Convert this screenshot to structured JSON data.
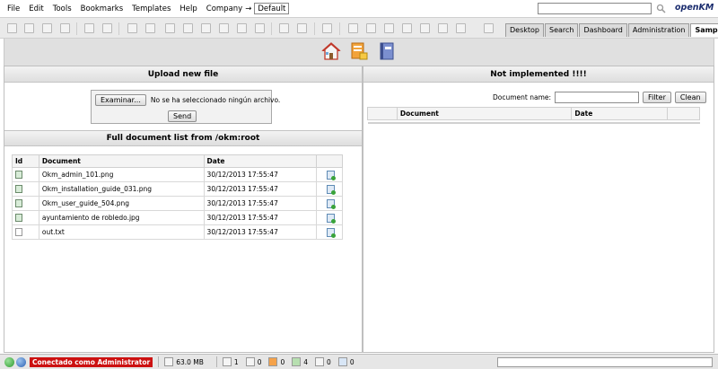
{
  "menu": {
    "items": [
      "File",
      "Edit",
      "Tools",
      "Bookmarks",
      "Templates",
      "Help"
    ],
    "company_label": "Company",
    "company_arrow": "→",
    "workspace_value": "Default"
  },
  "logo": {
    "brand": "openKM",
    "text_main": "penKM",
    "o_part": "o"
  },
  "tabs": [
    "Desktop",
    "Search",
    "Dashboard",
    "Administration",
    "Sample"
  ],
  "active_tab": "Sample",
  "upload": {
    "title": "Upload new file",
    "browse_label": "Examinar...",
    "file_status": "No se ha seleccionado ningún archivo.",
    "send_label": "Send"
  },
  "doc_list": {
    "title": "Full document list from /okm:root",
    "columns": [
      "Id",
      "Document",
      "Date"
    ],
    "rows": [
      {
        "document": "Okm_admin_101.png",
        "date": "30/12/2013 17:55:47",
        "type": "image"
      },
      {
        "document": "Okm_installation_guide_031.png",
        "date": "30/12/2013 17:55:47",
        "type": "image"
      },
      {
        "document": "Okm_user_guide_504.png",
        "date": "30/12/2013 17:55:47",
        "type": "image"
      },
      {
        "document": "ayuntamiento de robledo.jpg",
        "date": "30/12/2013 17:55:47",
        "type": "image"
      },
      {
        "document": "out.txt",
        "date": "30/12/2013 17:55:47",
        "type": "text"
      }
    ]
  },
  "not_implemented": {
    "title": "Not implemented !!!!",
    "search_label": "Document name:",
    "filter_label": "Filter",
    "clean_label": "Clean",
    "columns": [
      "Document",
      "Date"
    ]
  },
  "status": {
    "connected_text": "Conectado como Administrator",
    "memory": "63.0 MB",
    "locked_count": "1",
    "checkout_count": "0",
    "subscribed_count": "0",
    "news_count": "4",
    "workflow_count": "0",
    "mail_count": "0"
  },
  "colors": {
    "status_red": "#cc1111",
    "panel_header": "#dedede",
    "logo_blue": "#1a2c6e"
  }
}
